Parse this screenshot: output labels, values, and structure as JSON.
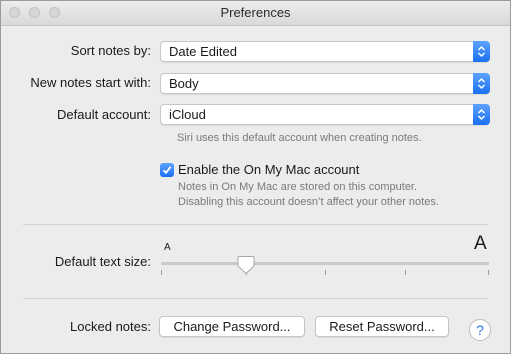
{
  "window": {
    "title": "Preferences"
  },
  "sort": {
    "label": "Sort notes by:",
    "value": "Date Edited"
  },
  "new_notes": {
    "label": "New notes start with:",
    "value": "Body"
  },
  "account": {
    "label": "Default account:",
    "value": "iCloud",
    "note": "Siri uses this default account when creating notes."
  },
  "onmymac": {
    "label": "Enable the On My Mac account",
    "checked": true,
    "note_line1": "Notes in On My Mac are stored on this computer.",
    "note_line2": "Disabling this account doesn’t affect your other notes."
  },
  "text_size": {
    "label": "Default text size:",
    "small_glyph": "A",
    "large_glyph": "A",
    "level_fraction": 0.26,
    "tick_count": 6
  },
  "locked": {
    "label": "Locked notes:",
    "change_button": "Change Password...",
    "reset_button": "Reset Password..."
  },
  "help": {
    "glyph": "?"
  },
  "colors": {
    "accent": "#1a6ff3",
    "window_bg": "#ececec"
  }
}
